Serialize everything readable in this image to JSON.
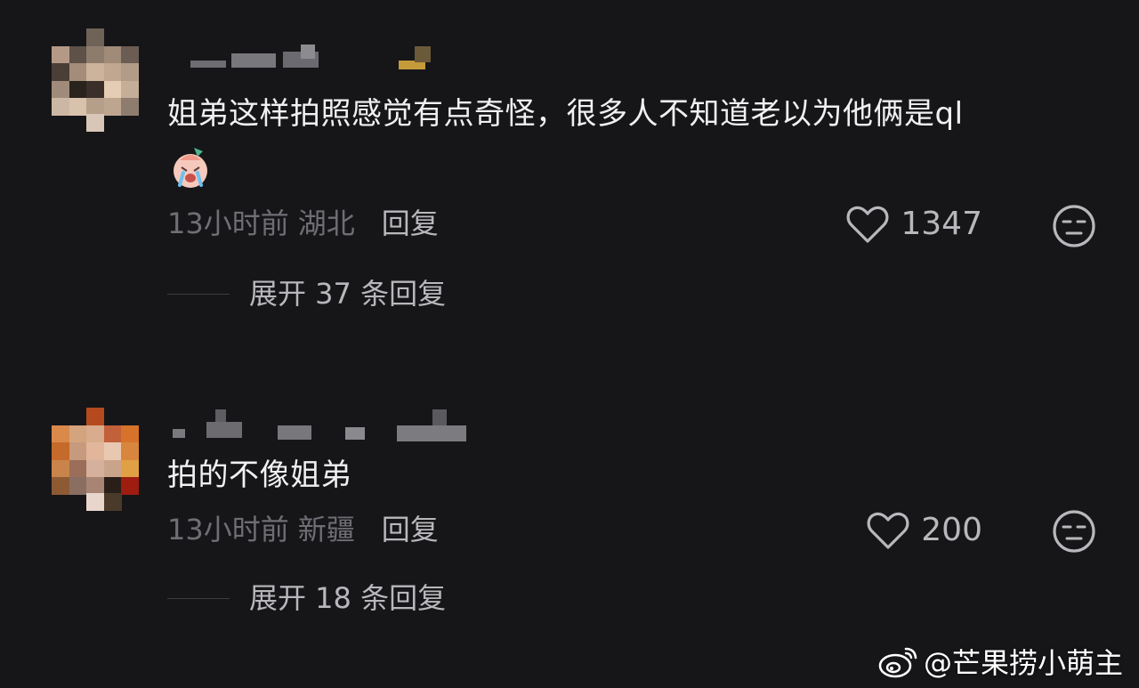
{
  "comments": [
    {
      "text": "姐弟这样拍照感觉有点奇怪，很多人不知道老以为他俩是ql",
      "emoji": "crying-face-emoji",
      "time": "13小时前",
      "location": "湖北",
      "reply_label": "回复",
      "likes": "1347",
      "expand_label": "展开 37 条回复"
    },
    {
      "text": "拍的不像姐弟",
      "time": "13小时前",
      "location": "新疆",
      "reply_label": "回复",
      "likes": "200",
      "expand_label": "展开 18 条回复"
    }
  ],
  "watermark": {
    "icon": "weibo-logo-icon",
    "text": "@芒果捞小萌主"
  },
  "colors": {
    "background": "#161619",
    "text_primary": "#f0f0f2",
    "text_secondary": "#6e6e74",
    "action_text": "#b8b8bc"
  }
}
